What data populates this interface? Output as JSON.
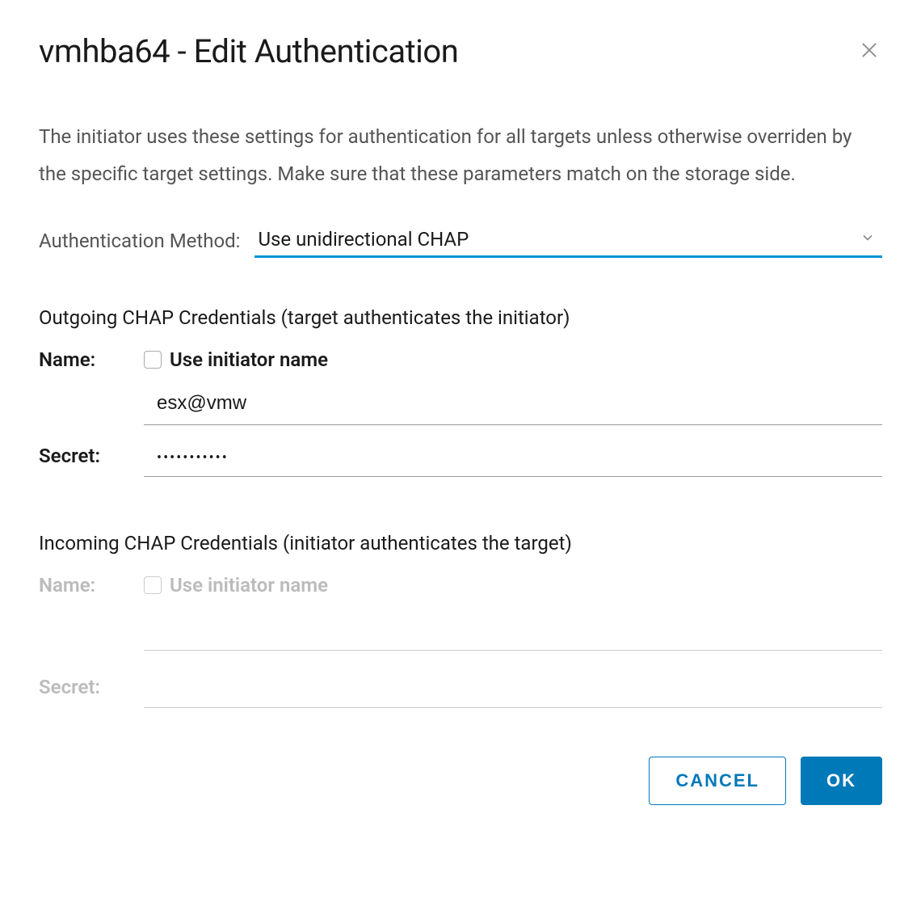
{
  "dialog": {
    "title": "vmhba64 - Edit Authentication",
    "description": "The initiator uses these settings for authentication for all targets unless otherwise overriden by the specific target settings. Make sure that these parameters match on the storage side."
  },
  "auth_method": {
    "label": "Authentication Method:",
    "value": "Use unidirectional CHAP"
  },
  "outgoing": {
    "heading": "Outgoing CHAP Credentials (target authenticates the initiator)",
    "name_label": "Name:",
    "use_initiator_label": "Use initiator name",
    "name_value": "esx@vmw",
    "secret_label": "Secret:",
    "secret_value": "•••••••••••"
  },
  "incoming": {
    "heading": "Incoming CHAP Credentials (initiator authenticates the target)",
    "name_label": "Name:",
    "use_initiator_label": "Use initiator name",
    "name_value": "",
    "secret_label": "Secret:",
    "secret_value": ""
  },
  "footer": {
    "cancel": "CANCEL",
    "ok": "OK"
  }
}
